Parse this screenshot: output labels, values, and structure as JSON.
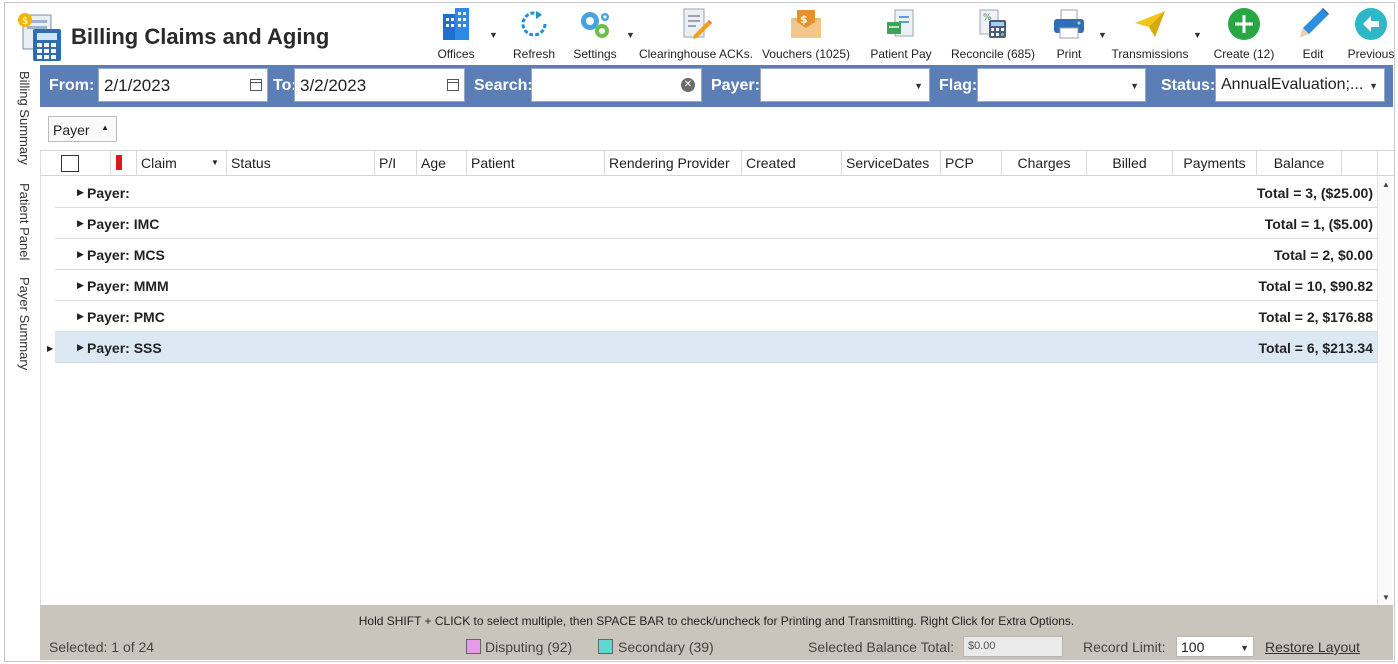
{
  "app": {
    "title": "Billing Claims and Aging"
  },
  "toolbar": {
    "offices": "Offices",
    "refresh": "Refresh",
    "settings": "Settings",
    "clearinghouse": "Clearinghouse ACKs.",
    "vouchers": "Vouchers (1025)",
    "patient_pay": "Patient Pay",
    "reconcile": "Reconcile (685)",
    "print": "Print",
    "transmissions": "Transmissions",
    "create": "Create (12)",
    "edit": "Edit",
    "previous": "Previous"
  },
  "side_tabs": [
    "Billing Summary",
    "Patient Panel",
    "Payer Summary"
  ],
  "filters": {
    "from_label": "From:",
    "from_value": "2/1/2023",
    "to_label": "To:",
    "to_value": "3/2/2023",
    "search_label": "Search:",
    "search_value": "",
    "payer_label": "Payer:",
    "payer_value": "",
    "flag_label": "Flag:",
    "flag_value": "",
    "status_label": "Status:",
    "status_value": "AnnualEvaluation;..."
  },
  "group_by": "Payer",
  "columns": {
    "claim": "Claim",
    "status": "Status",
    "pi": "P/I",
    "age": "Age",
    "patient": "Patient",
    "rendering_provider": "Rendering Provider",
    "created": "Created",
    "service_dates": "ServiceDates",
    "pcp": "PCP",
    "charges": "Charges",
    "billed": "Billed",
    "payments": "Payments",
    "balance": "Balance"
  },
  "groups": [
    {
      "name": "Payer:",
      "total": "Total = 3,  ($25.00)"
    },
    {
      "name": "Payer: IMC",
      "total": "Total = 1,  ($5.00)"
    },
    {
      "name": "Payer: MCS",
      "total": "Total = 2,  $0.00"
    },
    {
      "name": "Payer: MMM",
      "total": "Total = 10,  $90.82"
    },
    {
      "name": "Payer: PMC",
      "total": "Total = 2,  $176.88"
    },
    {
      "name": "Payer: SSS",
      "total": "Total = 6,  $213.34"
    }
  ],
  "footer": {
    "hint": "Hold SHIFT + CLICK to select multiple, then SPACE BAR to check/uncheck for Printing and Transmitting. Right Click for Extra Options.",
    "selected": "Selected: 1 of 24",
    "disputing": "Disputing (92)",
    "secondary": "Secondary (39)",
    "selected_balance_label": "Selected Balance Total:",
    "selected_balance_value": "$0.00",
    "record_limit_label": "Record Limit:",
    "record_limit_value": "100",
    "restore_layout": "Restore Layout"
  },
  "colors": {
    "filter_bar": "#5a7eb5",
    "footer": "#c9c5bd",
    "selected_row": "#dde8f5",
    "flag_red": "#e3161b",
    "disputing": "#e79ae8",
    "secondary": "#5fd8d2"
  }
}
